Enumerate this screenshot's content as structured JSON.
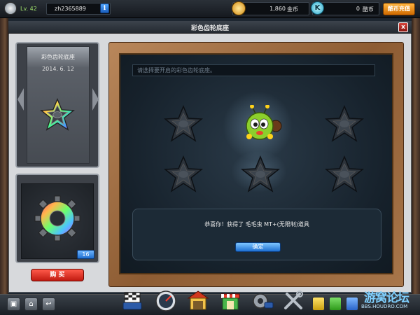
{
  "topbar": {
    "level": "Lv. 42",
    "username": "zh2365889",
    "info_icon": "i",
    "coins": "1,860",
    "coins_label": "金币",
    "k_icon": "K",
    "k_coins": "0",
    "k_coins_label": "酷币",
    "recharge_label": "酷币充值"
  },
  "dialog": {
    "title": "彩色齿轮底座",
    "close_icon": "x"
  },
  "selector": {
    "item_name": "彩色齿轮底座",
    "date": "2014. 6. 12"
  },
  "item_box": {
    "quantity": "16",
    "buy_label": "购 买"
  },
  "board": {
    "prompt": "请选择要开启的彩色齿轮底座。",
    "result_message": "恭喜你！获得了 毛毛虫 MT+(无限制)道具",
    "ok_label": "确定"
  },
  "bottombar": {
    "forum_logo": "游窝论坛",
    "forum_url": "BBS.HOUDRO.COM"
  },
  "colors": {
    "accent_orange": "#f08a1a",
    "buy_red": "#d8261a",
    "ok_blue": "#2a7fe0",
    "level_green": "#9fe06b"
  }
}
